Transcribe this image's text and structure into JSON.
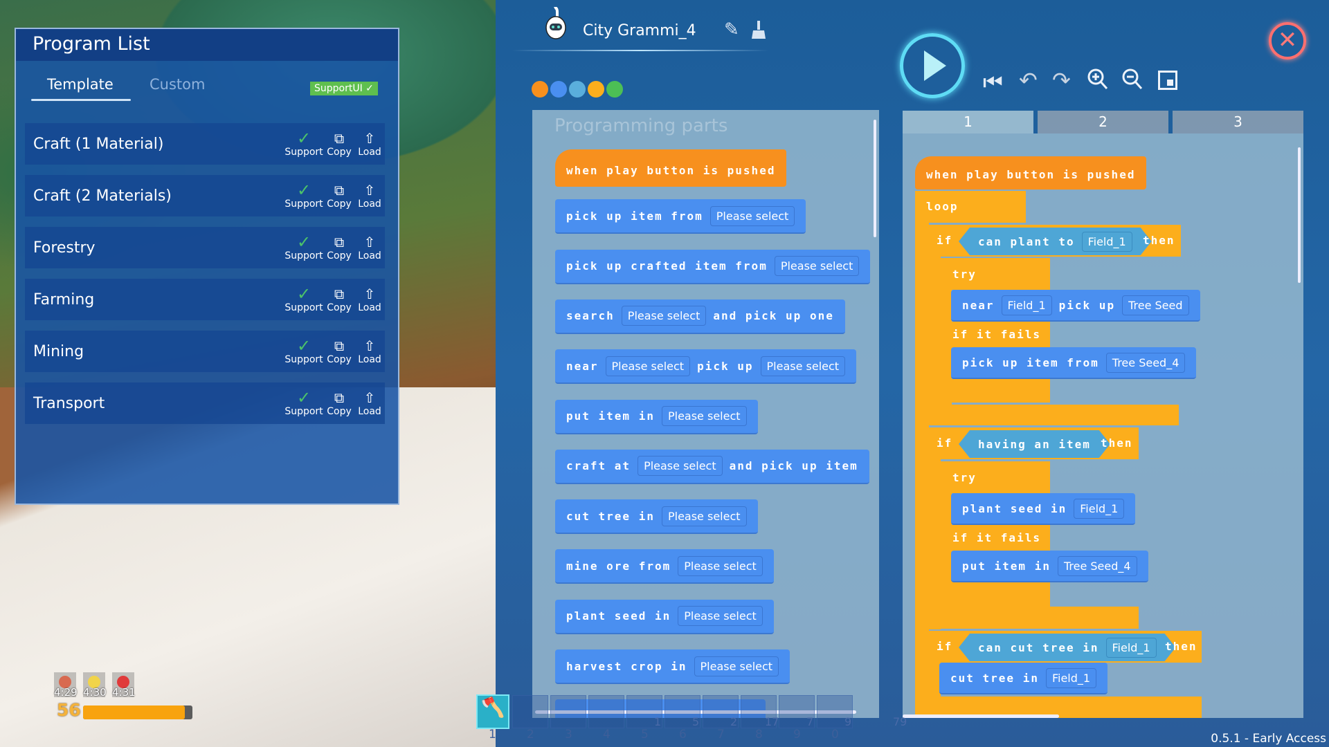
{
  "program_list": {
    "title": "Program List",
    "tabs": [
      {
        "label": "Template",
        "active": true
      },
      {
        "label": "Custom",
        "active": false
      }
    ],
    "support_badge": "SupportUI ✓",
    "action_labels": {
      "support": "Support",
      "copy": "Copy",
      "load": "Load"
    },
    "items": [
      {
        "name": "Craft (1 Material)"
      },
      {
        "name": "Craft (2 Materials)"
      },
      {
        "name": "Forestry"
      },
      {
        "name": "Farming"
      },
      {
        "name": "Mining"
      },
      {
        "name": "Transport"
      }
    ]
  },
  "editor": {
    "robot_name": "City Grammi_4",
    "palette_colors": [
      "#f7901e",
      "#4a8ff0",
      "#5aaedc",
      "#fcae1c",
      "#4cbf55"
    ],
    "palette_title": "Programming parts",
    "palette_blocks": [
      {
        "kind": "hat",
        "parts": [
          {
            "t": "when play button is pushed"
          }
        ]
      },
      {
        "kind": "act",
        "parts": [
          {
            "t": "pick up item from"
          },
          {
            "s": "Please select"
          }
        ]
      },
      {
        "kind": "act",
        "parts": [
          {
            "t": "pick up crafted item from"
          },
          {
            "s": "Please select"
          }
        ]
      },
      {
        "kind": "act",
        "parts": [
          {
            "t": "search"
          },
          {
            "s": "Please select"
          },
          {
            "t": "and pick up one"
          }
        ]
      },
      {
        "kind": "act",
        "parts": [
          {
            "t": "near"
          },
          {
            "s": "Please select"
          },
          {
            "t": "pick up"
          },
          {
            "s": "Please select"
          }
        ]
      },
      {
        "kind": "act",
        "parts": [
          {
            "t": "put item in"
          },
          {
            "s": "Please select"
          }
        ]
      },
      {
        "kind": "act",
        "parts": [
          {
            "t": "craft at"
          },
          {
            "s": "Please select"
          },
          {
            "t": "and pick up item"
          }
        ]
      },
      {
        "kind": "act",
        "parts": [
          {
            "t": "cut tree in"
          },
          {
            "s": "Please select"
          }
        ]
      },
      {
        "kind": "act",
        "parts": [
          {
            "t": "mine ore from"
          },
          {
            "s": "Please select"
          }
        ]
      },
      {
        "kind": "act",
        "parts": [
          {
            "t": "plant seed in"
          },
          {
            "s": "Please select"
          }
        ]
      },
      {
        "kind": "act",
        "parts": [
          {
            "t": "harvest crop in"
          },
          {
            "s": "Please select"
          }
        ]
      }
    ],
    "code_tabs": [
      "1",
      "2",
      "3"
    ],
    "active_code_tab": "1",
    "code": {
      "hat": "when play button is pushed",
      "loop": "loop",
      "if": "if",
      "then": "then",
      "try": "try",
      "if_fails": "if it fails",
      "cond1": {
        "t": "can plant to",
        "s": "Field_1"
      },
      "cond2": {
        "t": "having an item"
      },
      "cond3": {
        "t": "can cut tree in",
        "s": "Field_1"
      },
      "blocks": [
        {
          "parts": [
            {
              "t": "near"
            },
            {
              "s": "Field_1"
            },
            {
              "t": "pick up"
            },
            {
              "s": "Tree Seed"
            }
          ]
        },
        {
          "parts": [
            {
              "t": "pick up item from"
            },
            {
              "s": "Tree Seed_4"
            }
          ]
        },
        {
          "parts": [
            {
              "t": "plant seed in"
            },
            {
              "s": "Field_1"
            }
          ]
        },
        {
          "parts": [
            {
              "t": "put item in"
            },
            {
              "s": "Tree Seed_4"
            }
          ]
        },
        {
          "parts": [
            {
              "t": "cut tree in"
            },
            {
              "s": "Field_1"
            }
          ]
        }
      ]
    }
  },
  "hud": {
    "timers": [
      "4:29",
      "4:30",
      "4:31"
    ],
    "level": "56",
    "xp_fraction": 0.93,
    "hotbar_numbers": [
      "1",
      "2",
      "3",
      "4",
      "5",
      "6",
      "7",
      "8",
      "9",
      "0"
    ],
    "hotbar_counts": [
      "1",
      "5",
      "2",
      "17",
      "7",
      "9",
      "79"
    ]
  },
  "version": "0.5.1 - Early Access"
}
